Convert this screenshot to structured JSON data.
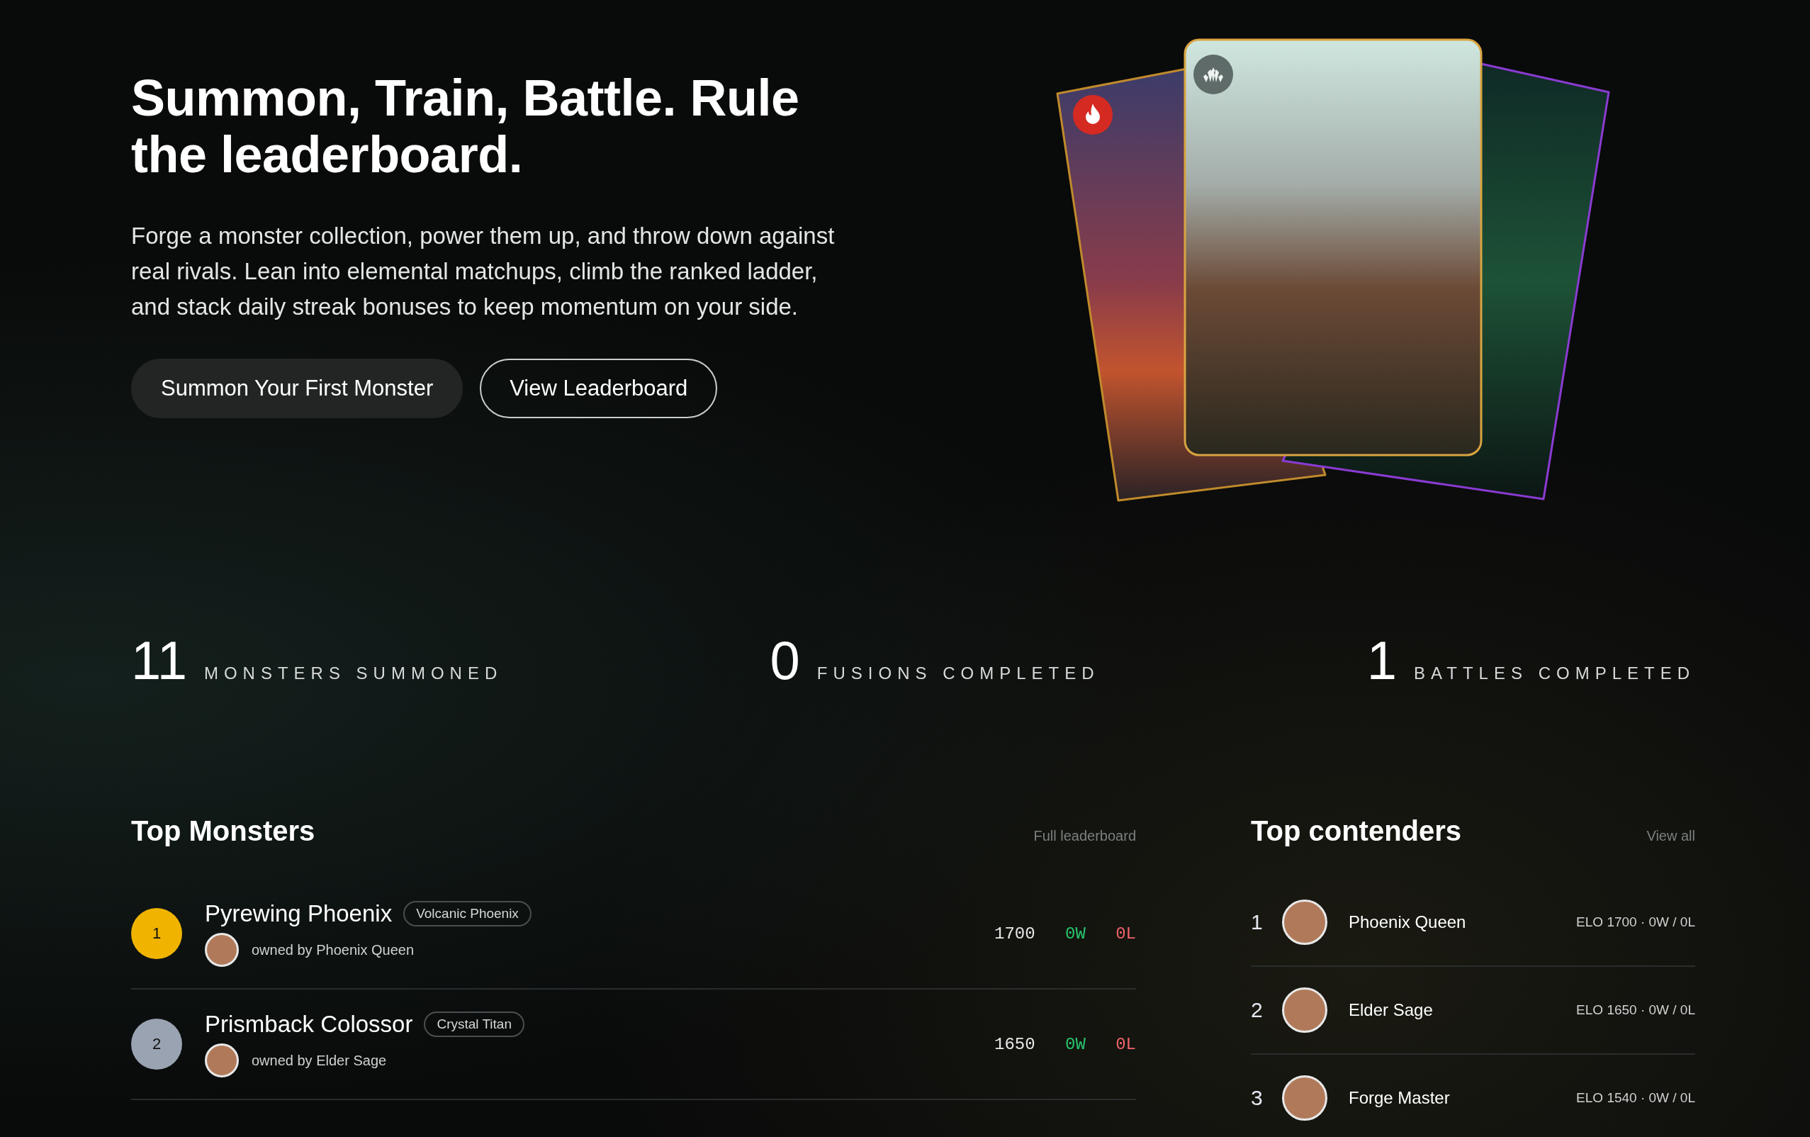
{
  "hero": {
    "title": "Summon, Train, Battle. Rule the leaderboard.",
    "description": "Forge a monster collection, power them up, and throw down against real rivals. Lean into elemental matchups, climb the ranked ladder, and stack daily streak bonuses to keep momentum on your side.",
    "buttons": [
      {
        "label": "Summon Your First Monster",
        "kind": "primary"
      },
      {
        "label": "View Leaderboard",
        "kind": "outline"
      }
    ]
  },
  "stats": [
    {
      "value": "11",
      "label": "MONSTERS SUMMONED"
    },
    {
      "value": "0",
      "label": "FUSIONS COMPLETED"
    },
    {
      "value": "1",
      "label": "BATTLES COMPLETED"
    }
  ],
  "top_monsters": {
    "title": "Top Monsters",
    "link": "Full leaderboard",
    "rows": [
      {
        "rank": "1",
        "color": "#f0b400",
        "name": "Pyrewing Phoenix",
        "species": "Volcanic Phoenix",
        "owner": "owned by Phoenix Queen",
        "elo": "1700",
        "wins": "0W",
        "losses": "0L"
      },
      {
        "rank": "2",
        "color": "#9aa3b2",
        "name": "Prismback Colossor",
        "species": "Crystal Titan",
        "owner": "owned by Elder Sage",
        "elo": "1650",
        "wins": "0W",
        "losses": "0L"
      }
    ]
  },
  "top_contenders": {
    "title": "Top contenders",
    "link": "View all",
    "rows": [
      {
        "rank": "1",
        "name": "Phoenix Queen",
        "stats": "ELO 1700 · 0W / 0L"
      },
      {
        "rank": "2",
        "name": "Elder Sage",
        "stats": "ELO 1650 · 0W / 0L"
      },
      {
        "rank": "3",
        "name": "Forge Master",
        "stats": "ELO 1540 · 0W / 0L"
      }
    ]
  }
}
